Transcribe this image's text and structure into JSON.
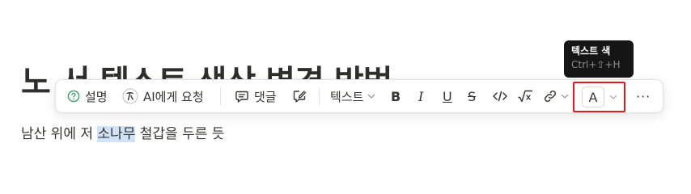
{
  "page": {
    "title_visible": "노 서 텍스트 색상 변경 방법",
    "body_before": "남산 위에 저 ",
    "body_selected": "소나무",
    "body_after": " 철갑을 두른 듯"
  },
  "toolbar": {
    "explain_label": "설명",
    "ask_ai_label": "AI에게 요청",
    "comment_label": "댓글",
    "text_type_label": "텍스트",
    "bold_glyph": "B",
    "italic_glyph": "I",
    "underline_glyph": "U",
    "strike_glyph": "S",
    "code_glyph": "</>",
    "color_glyph": "A",
    "more_glyph": "···"
  },
  "tooltip": {
    "title": "텍스트 색",
    "shortcut": "Ctrl+⇧+H"
  },
  "colors": {
    "highlight_box": "#e01b24",
    "selection": "#cfe2f8",
    "tooltip_bg": "#151515"
  },
  "icons": [
    "question-circle-icon",
    "ai-pen-icon",
    "comment-icon",
    "edit-comment-icon",
    "chevron-down-icon",
    "code-icon",
    "math-sqrt-icon",
    "link-icon",
    "more-icon"
  ]
}
